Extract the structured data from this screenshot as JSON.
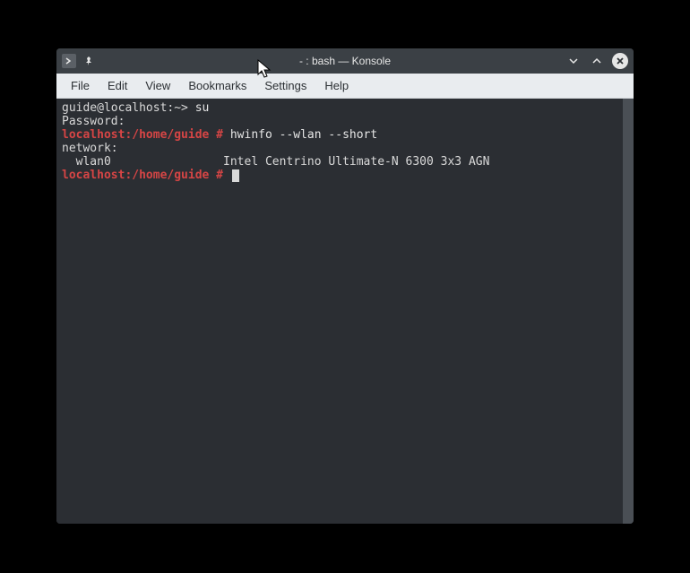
{
  "window": {
    "title": "- : bash — Konsole"
  },
  "menubar": {
    "items": [
      "File",
      "Edit",
      "View",
      "Bookmarks",
      "Settings",
      "Help"
    ]
  },
  "terminal": {
    "lines": [
      {
        "type": "user-prompt",
        "prompt": "guide@localhost:~>",
        "command": " su"
      },
      {
        "type": "plain",
        "text": "Password:"
      },
      {
        "type": "root-prompt",
        "prompt": "localhost:/home/guide #",
        "command": " hwinfo --wlan --short"
      },
      {
        "type": "plain",
        "text": "network:"
      },
      {
        "type": "plain",
        "text": "  wlan0                Intel Centrino Ultimate-N 6300 3x3 AGN"
      },
      {
        "type": "root-prompt-cursor",
        "prompt": "localhost:/home/guide #",
        "command": " "
      }
    ]
  }
}
